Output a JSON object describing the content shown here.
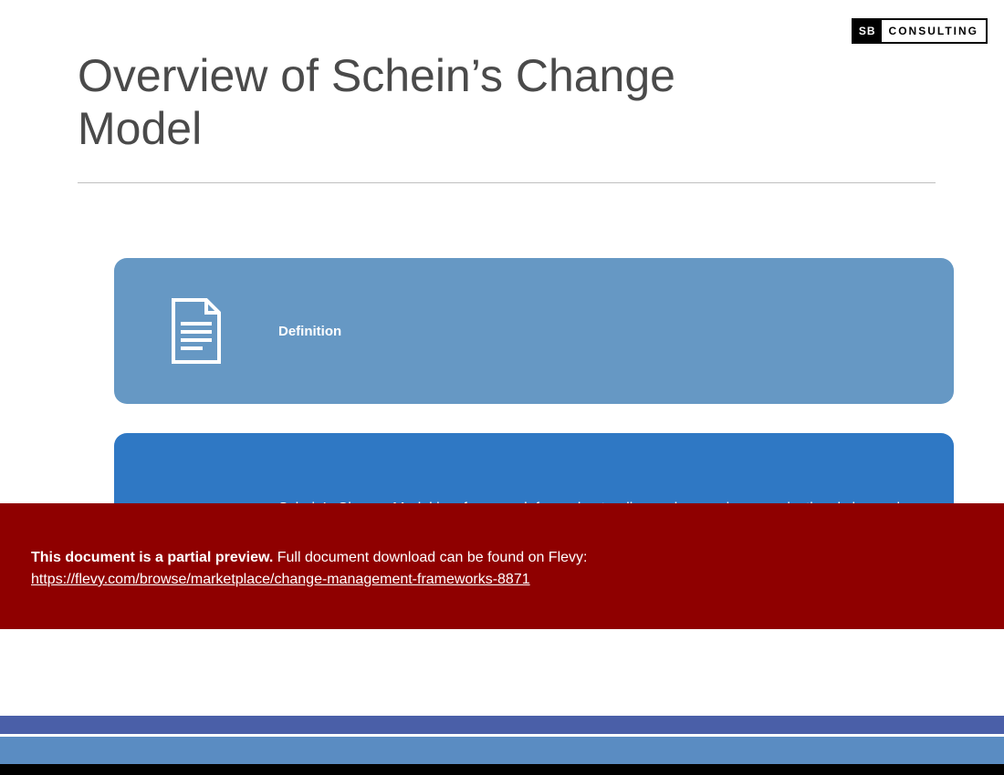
{
  "logo": {
    "initials": "SB",
    "word": "CONSULTING"
  },
  "title": "Overview of Schein’s Change Model",
  "card1": {
    "label": "Definition"
  },
  "card2": {
    "desc": "Schein’s Change Model is a framework for understanding and managing organizational change by focusing on the cultural elements that influence"
  },
  "banner": {
    "bold": "This document is a partial preview.",
    "rest": "  Full document download can be found on Flevy:",
    "url": "https://flevy.com/browse/marketplace/change-management-frameworks-8871"
  }
}
